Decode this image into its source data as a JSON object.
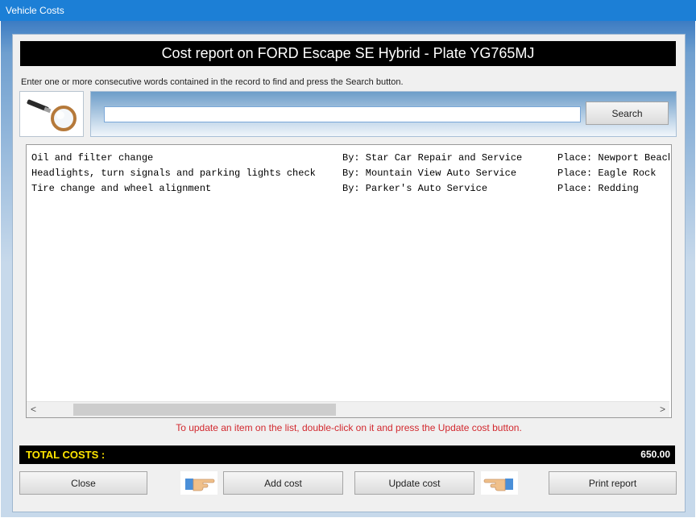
{
  "window": {
    "title": "Vehicle Costs"
  },
  "header": {
    "title": "Cost report on FORD Escape SE Hybrid - Plate YG765MJ"
  },
  "instruction": "Enter one or more consecutive words contained in the record to find and press the Search button.",
  "search": {
    "value": "",
    "button_label": "Search"
  },
  "records": [
    {
      "desc": "Oil and filter change",
      "by": "By: Star Car Repair and Service",
      "place": "Place: Newport Beach"
    },
    {
      "desc": "Headlights, turn signals and parking lights check",
      "by": "By: Mountain View Auto Service",
      "place": "Place: Eagle Rock"
    },
    {
      "desc": "Tire change and wheel alignment",
      "by": "By: Parker's Auto Service",
      "place": "Place: Redding"
    }
  ],
  "update_hint": "To update an item on the list, double-click on it and press the Update cost button.",
  "totals": {
    "label": "TOTAL COSTS :",
    "value": "650.00"
  },
  "buttons": {
    "close": "Close",
    "add": "Add cost",
    "update": "Update cost",
    "print": "Print report"
  },
  "icons": {
    "search": "magnifier-icon",
    "hand": "pointing-hand-icon"
  }
}
